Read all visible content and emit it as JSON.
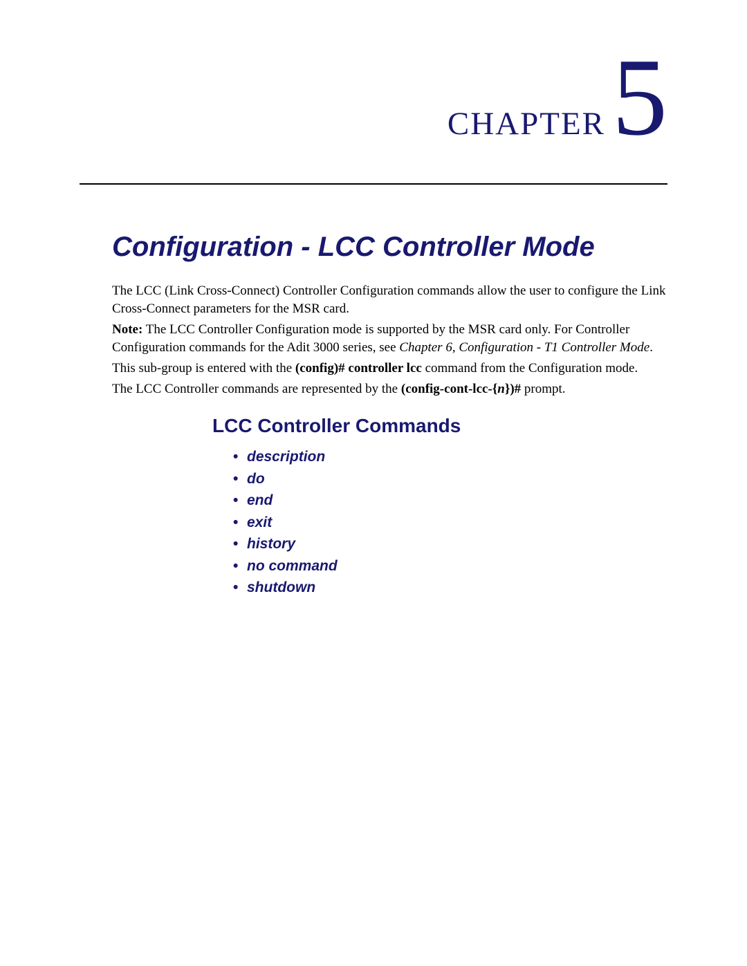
{
  "chapter": {
    "label": "CHAPTER",
    "number": "5"
  },
  "title": "Configuration - LCC Controller Mode",
  "paragraphs": {
    "p1": "The LCC (Link Cross-Connect) Controller Configuration commands allow the user to configure the Link Cross-Connect parameters for the MSR card.",
    "p2_note_label": "Note:",
    "p2_text": "  The LCC Controller Configuration mode is supported by the MSR card only.  For Controller Configuration commands for the Adit 3000 series, see ",
    "p2_ref": "Chapter 6, Configuration - T1 Controller Mode",
    "p2_end": ".",
    "p3_pre": "This sub-group is entered with the ",
    "p3_bold": "(config)# controller lcc",
    "p3_post": " command from the Configuration mode.",
    "p4_pre": "The LCC Controller commands are represented by the ",
    "p4_bold": "(config-cont-lcc-{",
    "p4_italic": "n",
    "p4_bold2": "})#",
    "p4_post": " prompt."
  },
  "subheading": "LCC Controller Commands",
  "commands": [
    "description",
    "do",
    "end",
    "exit",
    "history",
    "no command",
    "shutdown"
  ]
}
